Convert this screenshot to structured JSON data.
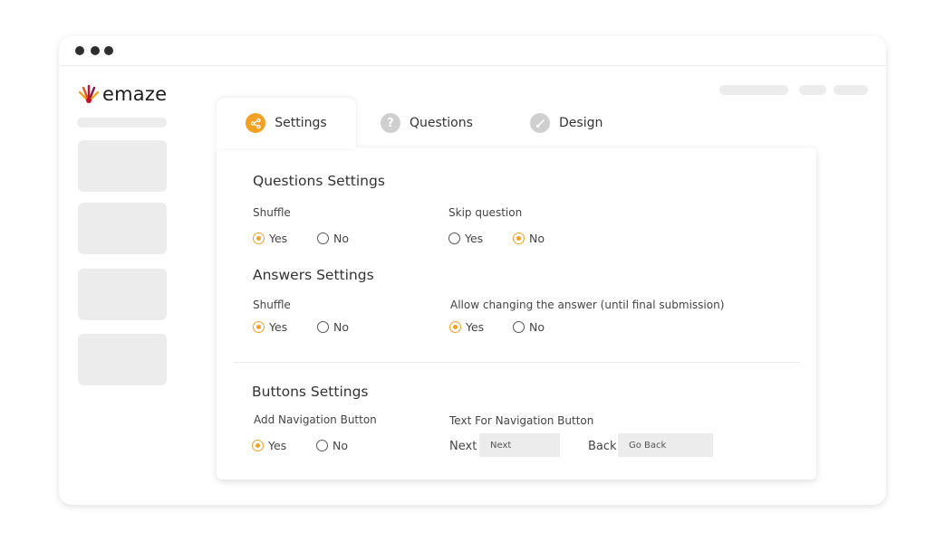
{
  "app": {
    "logo_text": "emaze"
  },
  "tabs": [
    {
      "label": "Settings",
      "icon": "share-icon",
      "active": true
    },
    {
      "label": "Questions",
      "icon": "question-icon",
      "active": false
    },
    {
      "label": "Design",
      "icon": "brush-icon",
      "active": false
    }
  ],
  "questions_settings": {
    "title": "Questions Settings",
    "shuffle": {
      "label": "Shuffle",
      "yes": "Yes",
      "no": "No",
      "selected": "Yes"
    },
    "skip": {
      "label": "Skip question",
      "yes": "Yes",
      "no": "No",
      "selected": "No"
    }
  },
  "answers_settings": {
    "title": "Answers Settings",
    "shuffle": {
      "label": "Shuffle",
      "yes": "Yes",
      "no": "No",
      "selected": "Yes"
    },
    "allow_change": {
      "label": "Allow changing the answer (until final submission)",
      "yes": "Yes",
      "no": "No",
      "selected": "Yes"
    }
  },
  "buttons_settings": {
    "title": "Buttons Settings",
    "add_nav": {
      "label": "Add Navigation Button",
      "yes": "Yes",
      "no": "No",
      "selected": "Yes"
    },
    "nav_text": {
      "label": "Text For Navigation Button",
      "next_label": "Next",
      "next_value": "Next",
      "back_label": "Back",
      "back_value": "Go Back"
    }
  },
  "colors": {
    "accent": "#f3a024",
    "skeleton": "#ececec",
    "logo_red": "#c8102e"
  }
}
